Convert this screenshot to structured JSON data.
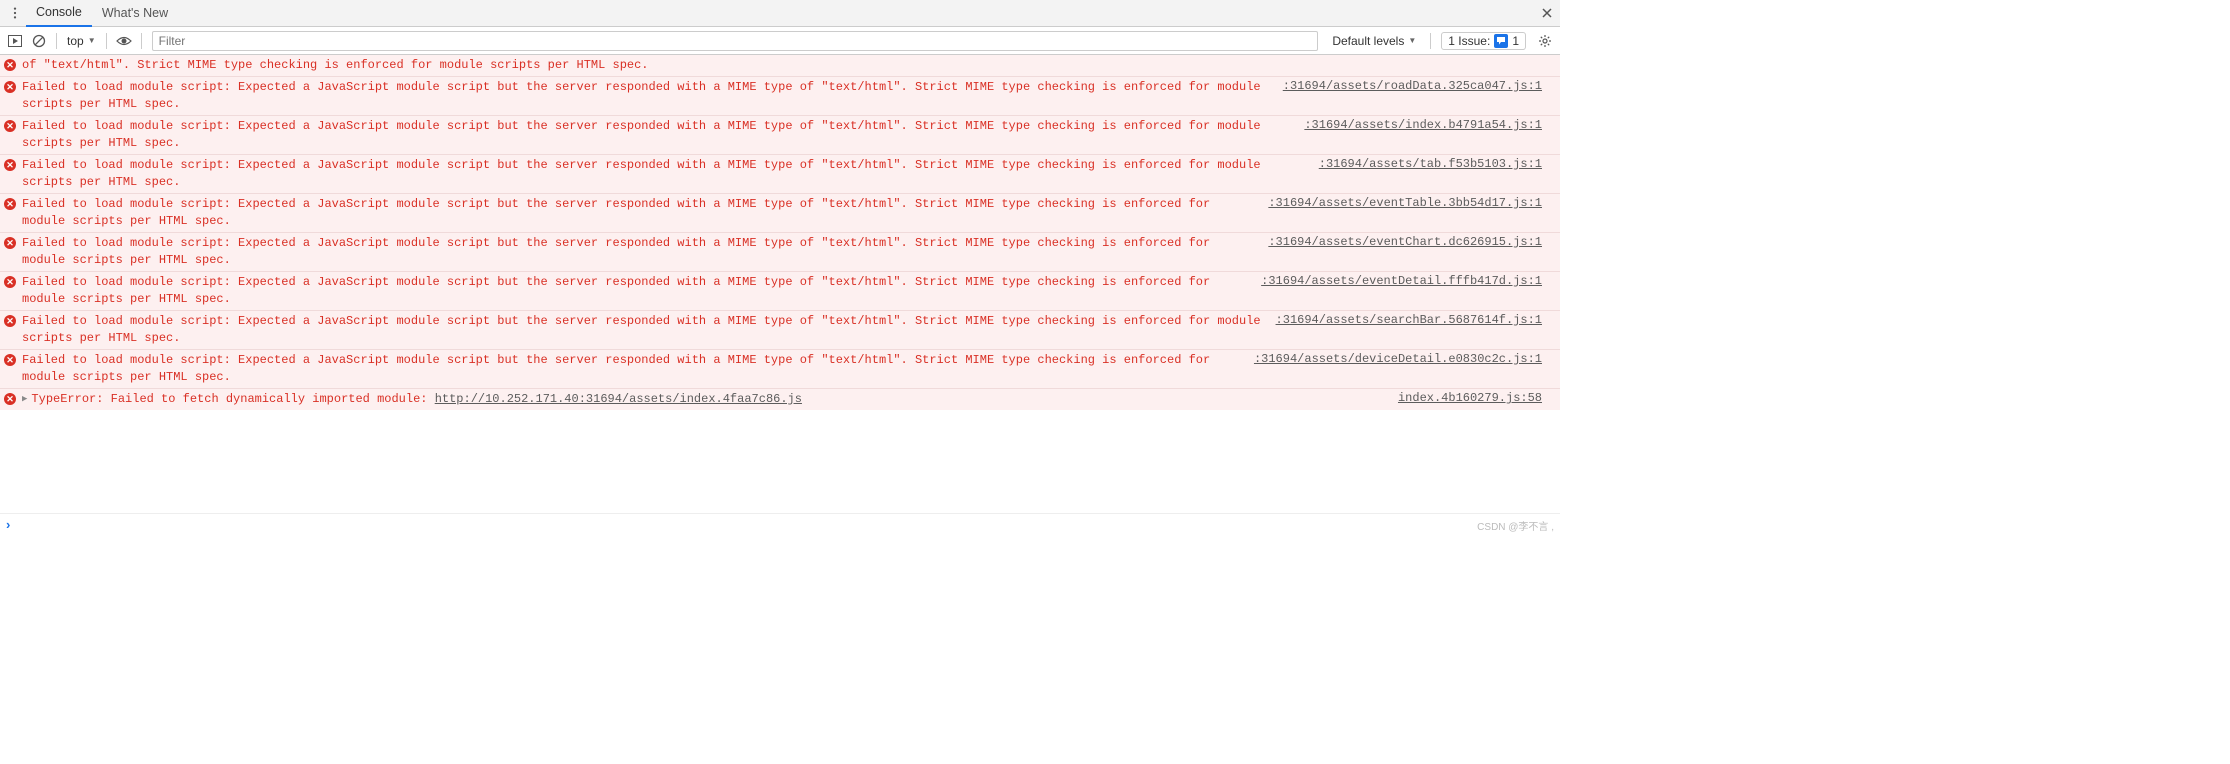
{
  "tabs": {
    "console": "Console",
    "whatsnew": "What's New"
  },
  "toolbar": {
    "context": "top",
    "filter_placeholder": "Filter",
    "levels_label": "Default levels",
    "issue_label": "1 Issue:",
    "issue_count": "1"
  },
  "messages": [
    {
      "text": "of \"text/html\". Strict MIME type checking is enforced for module scripts per HTML spec.",
      "source": "",
      "expandable": false
    },
    {
      "text": "Failed to load module script: Expected a JavaScript module script but the server responded with a MIME type of \"text/html\". Strict MIME type checking is enforced for module scripts per HTML spec.",
      "source": ":31694/assets/roadData.325ca047.js:1",
      "expandable": false
    },
    {
      "text": "Failed to load module script: Expected a JavaScript module script but the server responded with a MIME type of \"text/html\". Strict MIME type checking is enforced for module scripts per HTML spec.",
      "source": ":31694/assets/index.b4791a54.js:1",
      "expandable": false
    },
    {
      "text": "Failed to load module script: Expected a JavaScript module script but the server responded with a MIME type of \"text/html\". Strict MIME type checking is enforced for module scripts per HTML spec.",
      "source": ":31694/assets/tab.f53b5103.js:1",
      "expandable": false
    },
    {
      "text": "Failed to load module script: Expected a JavaScript module script but the server responded with a MIME type of \"text/html\". Strict MIME type checking is enforced for module scripts per HTML spec.",
      "source": ":31694/assets/eventTable.3bb54d17.js:1",
      "expandable": false
    },
    {
      "text": "Failed to load module script: Expected a JavaScript module script but the server responded with a MIME type of \"text/html\". Strict MIME type checking is enforced for module scripts per HTML spec.",
      "source": ":31694/assets/eventChart.dc626915.js:1",
      "expandable": false
    },
    {
      "text": "Failed to load module script: Expected a JavaScript module script but the server responded with a MIME type of \"text/html\". Strict MIME type checking is enforced for module scripts per HTML spec.",
      "source": ":31694/assets/eventDetail.fffb417d.js:1",
      "expandable": false
    },
    {
      "text": "Failed to load module script: Expected a JavaScript module script but the server responded with a MIME type of \"text/html\". Strict MIME type checking is enforced for module scripts per HTML spec.",
      "source": ":31694/assets/searchBar.5687614f.js:1",
      "expandable": false
    },
    {
      "text": "Failed to load module script: Expected a JavaScript module script but the server responded with a MIME type of \"text/html\". Strict MIME type checking is enforced for module scripts per HTML spec.",
      "source": ":31694/assets/deviceDetail.e0830c2c.js:1",
      "expandable": false
    },
    {
      "text_prefix": "TypeError: Failed to fetch dynamically imported module: ",
      "text_link": "http://10.252.171.40:31694/assets/index.4faa7c86.js",
      "source": "index.4b160279.js:58",
      "expandable": true
    }
  ],
  "watermark": "CSDN @李不言 ,"
}
